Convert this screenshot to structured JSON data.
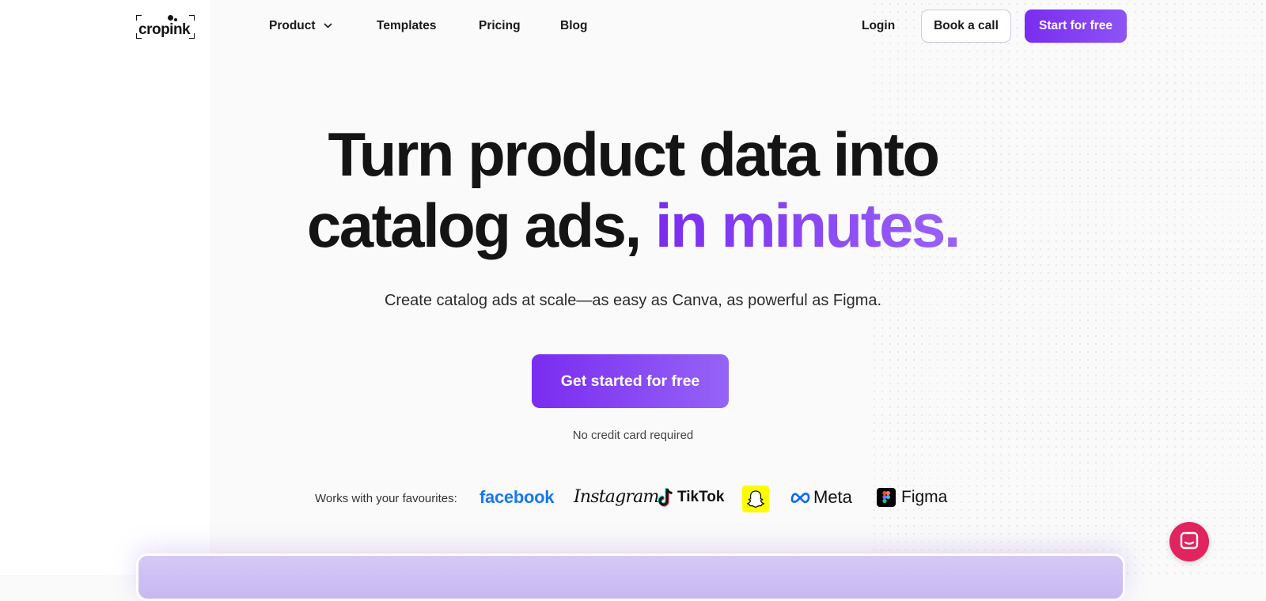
{
  "brand": {
    "name": "cropink"
  },
  "nav": {
    "product": "Product",
    "templates": "Templates",
    "pricing": "Pricing",
    "blog": "Blog",
    "login": "Login",
    "book_call": "Book a call",
    "start_free": "Start for free"
  },
  "hero": {
    "line1": "Turn product data into",
    "line2_main": "catalog ads,",
    "line2_accent": "in minutes.",
    "subtitle": "Create catalog ads at scale—as easy as Canva, as powerful as Figma.",
    "cta": "Get started for free",
    "note": "No credit card required"
  },
  "partners": {
    "label": "Works with your favourites:",
    "facebook": "facebook",
    "instagram": "Instagram",
    "tiktok": "TikTok",
    "meta": "Meta",
    "figma": "Figma"
  },
  "colors": {
    "accent": "#7a2cf0",
    "accent_light": "#9a62f7",
    "facebook_blue": "#1877f2",
    "snapchat_yellow": "#fffc00",
    "chat_pink": "#e0245e"
  },
  "icons": {
    "product_dropdown": "chevron-down-icon",
    "tiktok": "tiktok-icon",
    "snapchat": "snapchat-ghost-icon",
    "meta": "meta-infinity-icon",
    "figma": "figma-icon",
    "chat": "chat-bubble-icon"
  }
}
